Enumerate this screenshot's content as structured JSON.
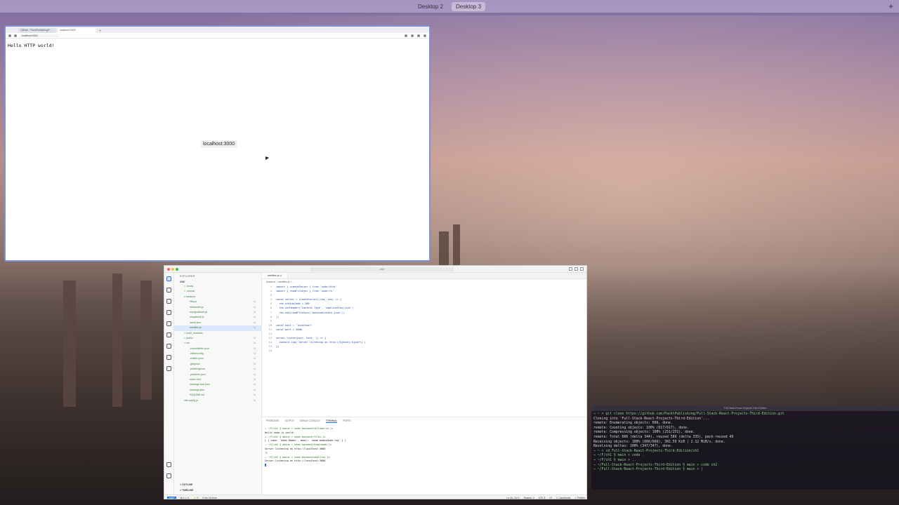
{
  "topbar": {
    "desktops": [
      "Desktop 2",
      "Desktop 3"
    ],
    "active": "Desktop 3",
    "add_glyph": "+"
  },
  "browser": {
    "tabs": [
      "GitHub - PacktPublishing/F...",
      "localhost:3000"
    ],
    "new_tab_glyph": "+",
    "url": "localhost:3000",
    "page_text": "Hello HTTP world!",
    "status_toast": "localhost:3000"
  },
  "vscode": {
    "title_search": "ch2",
    "sidebar": {
      "header": "EXPLORER",
      "root": "CH2",
      "items": [
        {
          "name": "> .husky",
          "status": ""
        },
        {
          "name": "> .vscode",
          "status": ""
        },
        {
          "name": "v backend",
          "status": ""
        },
        {
          "name": "files.js",
          "status": "U"
        },
        {
          "name": "helloworld.js",
          "status": "U"
        },
        {
          "name": "mongodbweb.js",
          "status": "U"
        },
        {
          "name": "simpleweb.js",
          "status": "U"
        },
        {
          "name": "users.json",
          "status": "U"
        },
        {
          "name": "webfiles.js",
          "status": "U"
        },
        {
          "name": "> node_modules",
          "status": ""
        },
        {
          "name": "> public",
          "status": "U"
        },
        {
          "name": "> src",
          "status": "U"
        },
        {
          "name": ".commitlintrc.json",
          "status": "U"
        },
        {
          "name": ".editorconfig",
          "status": "U"
        },
        {
          "name": ".eslintrc.json",
          "status": "U"
        },
        {
          "name": ".gitignore",
          "status": "U"
        },
        {
          "name": ".prettierignore",
          "status": "U"
        },
        {
          "name": ".prettierrc.json",
          "status": "U"
        },
        {
          "name": "index.html",
          "status": "U"
        },
        {
          "name": "package-lock.json",
          "status": "U"
        },
        {
          "name": "package.json",
          "status": "U"
        },
        {
          "name": "README.md",
          "status": "U"
        },
        {
          "name": "vite.config.js",
          "status": "U"
        }
      ],
      "outline": "> OUTLINE",
      "timeline": "> TIMELINE"
    },
    "editor": {
      "tab": "webfiles.js U",
      "breadcrumb": "backend > webfiles.js > ...",
      "lines": [
        {
          "n": "1",
          "t": "import { createServer } from 'node:http'"
        },
        {
          "n": "2",
          "t": "import { readFileSync } from 'node:fs'"
        },
        {
          "n": "3",
          "t": ""
        },
        {
          "n": "4",
          "t": "const server = createServer((req, res) => {"
        },
        {
          "n": "5",
          "t": "  res.statusCode = 200"
        },
        {
          "n": "6",
          "t": "  res.setHeader('Content-Type', 'application/json')"
        },
        {
          "n": "7",
          "t": "  res.end(readFileSync('backend/users.json'))"
        },
        {
          "n": "8",
          "t": "})"
        },
        {
          "n": "9",
          "t": ""
        },
        {
          "n": "10",
          "t": "const host = 'localhost'"
        },
        {
          "n": "11",
          "t": "const port = 3000"
        },
        {
          "n": "12",
          "t": ""
        },
        {
          "n": "13",
          "t": "server.listen(port, host, () => {"
        },
        {
          "n": "14",
          "t": "  console.log(`Server listening on http://${host}:${port}`)"
        },
        {
          "n": "15",
          "t": "})"
        },
        {
          "n": "16",
          "t": ""
        }
      ]
    },
    "panel": {
      "tabs": [
        "PROBLEMS",
        "OUTPUT",
        "DEBUG CONSOLE",
        "TERMINAL",
        "PORTS"
      ],
      "active": "TERMINAL",
      "terminal_lines": [
        "→ ~/F/ch2 § main± > node backend/helloworld.js",
        "Hello node.js world!",
        "→ ~/F/ch2 § main± > node backend/files.js",
        "[ { name: 'Adam Bobbs', email: 'adam.bobbs@web.log' } ]",
        "→ ~/F/ch2 § main± > node backend/simpleweb.js",
        "Server listening on http://localhost:3000",
        "^C",
        "→ ~/F/ch2 § main± > node backend/webfiles.js",
        "Server listening on http://localhost:3000"
      ]
    },
    "status": {
      "left": [
        "main*",
        "⊗ 0 ⚠ 0",
        "⚡ 0",
        "0 hrs 18 mins"
      ],
      "right": [
        "Ln 16, Col 1",
        "Spaces: 2",
        "UTF-8",
        "LF",
        "{ } JavaScript",
        "✓ Prettier"
      ]
    }
  },
  "right_terminal": {
    "title": "Full-Stack-React-Projects-Third-Edition",
    "lines": [
      "→ ~ > git clone https://github.com/PacktPublishing/Full-Stack-React-Projects-Third-Edition.git",
      "Cloning into 'Full-Stack-React-Projects-Third-Edition'...",
      "remote: Enumerating objects: 666, done.",
      "remote: Counting objects: 100% (617/617), done.",
      "remote: Compressing objects: 100% (251/251), done.",
      "remote: Total 666 (delta 344), reused 589 (delta 335), pack-reused 49",
      "Receiving objects: 100% (666/666), 302.59 KiB | 2.12 MiB/s, done.",
      "Resolving deltas: 100% (347/347), done.",
      "→ ~ > cd Full-Stack-React-Projects-Third-Edition/ch1",
      "→ ~/F/ch1 § main > code .",
      "→ ~/F/ch1 § main > ..",
      "→ ~/Full-Stack-React-Projects-Third-Edition § main > code ch2",
      "→ ~/Full-Stack-React-Projects-Third-Edition § main > |"
    ]
  },
  "colors": {
    "accent": "#1f6feb",
    "git_untracked": "#3a7f3a",
    "browser_border": "#7b93d6"
  }
}
